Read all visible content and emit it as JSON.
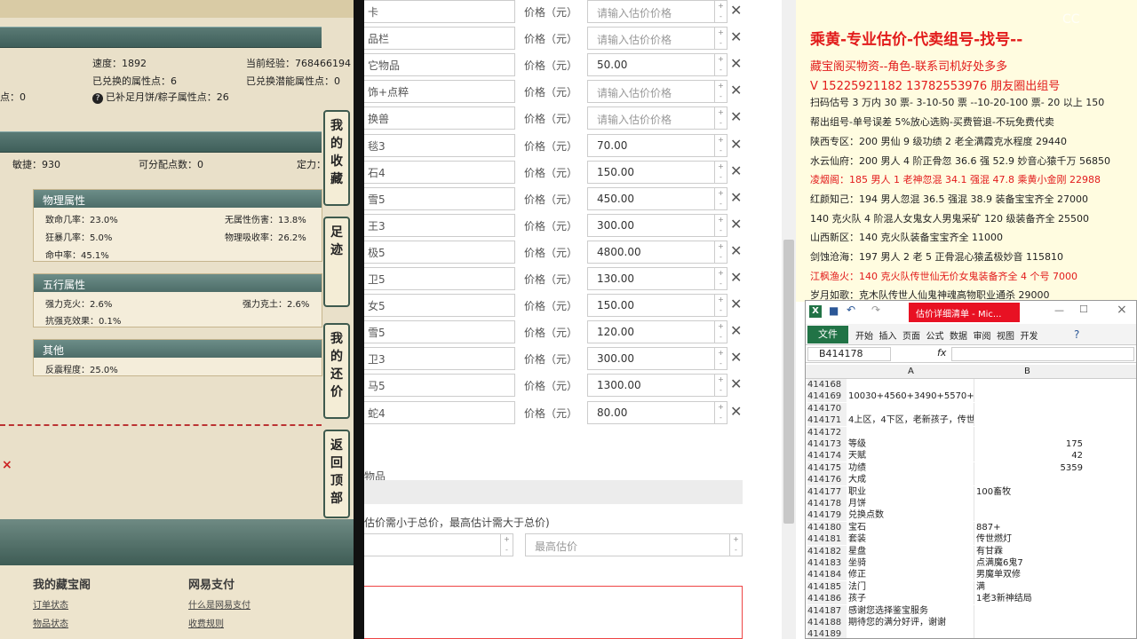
{
  "game": {
    "stats_row1": [
      "速度：1892",
      "当前经验：768466194"
    ],
    "stats_row2": [
      "已兑换的属性点：6",
      "已兑换潜能属性点：0"
    ],
    "stats_row3": [
      "点：0",
      "已补足月饼/粽子属性点：26"
    ],
    "stats_row4": [
      "敏捷：930",
      "可分配点数：0",
      "定力："
    ],
    "physical": {
      "title": "物理属性",
      "items": [
        "致命几率：23.0%",
        "无属性伤害：13.8%",
        "狂暴几率：5.0%",
        "物理吸收率：26.2%",
        "命中率：45.1%"
      ]
    },
    "five_elements": {
      "title": "五行属性",
      "items": [
        "强力克火：2.6%",
        "强力克土：2.6%",
        "抗强克效果：0.1%"
      ]
    },
    "other": {
      "title": "其他",
      "items": [
        "反震程度：25.0%"
      ]
    },
    "tabs": [
      "我的收藏",
      "足迹",
      "我的还价",
      "返回顶部"
    ],
    "footer": {
      "col1_title": "我的藏宝阁",
      "col1_links": [
        "订单状态",
        "物品状态"
      ],
      "col2_title": "网易支付",
      "col2_links": [
        "什么是网易支付",
        "收费规则"
      ]
    }
  },
  "form": {
    "price_label": "价格（元）",
    "placeholder": "请输入估价价格",
    "rows": [
      {
        "name": "卡",
        "price": ""
      },
      {
        "name": "品栏",
        "price": ""
      },
      {
        "name": "它物品",
        "price": "50.00"
      },
      {
        "name": "饰+点粹",
        "price": ""
      },
      {
        "name": "换兽",
        "price": ""
      },
      {
        "name": "毯3",
        "price": "70.00"
      },
      {
        "name": "石4",
        "price": "150.00"
      },
      {
        "name": "雪5",
        "price": "450.00"
      },
      {
        "name": "王3",
        "price": "300.00"
      },
      {
        "name": "极5",
        "price": "4800.00"
      },
      {
        "name": "卫5",
        "price": "130.00"
      },
      {
        "name": "女5",
        "price": "150.00"
      },
      {
        "name": "雪5",
        "price": "120.00"
      },
      {
        "name": "卫3",
        "price": "300.00"
      },
      {
        "name": "马5",
        "price": "1300.00"
      },
      {
        "name": "蛇4",
        "price": "80.00"
      }
    ],
    "section_label": "物品",
    "hint": "估价需小于总价，最高估计需大于总价)",
    "max_placeholder": "最高估价"
  },
  "ad": {
    "title": "乘黄-专业估价-代卖组号-找号--",
    "lines": [
      {
        "text": "藏宝阁买物资--角色-联系司机好处多多",
        "red": true
      },
      {
        "text": "V 15225921182   13782553976 朋友圈出组号",
        "red": true
      },
      {
        "text": "扫码估号 3 万内 30 票- 3-10-50 票  --10-20-100 票- 20 以上 150",
        "red": false
      },
      {
        "text": "帮出组号-单号误差 5%放心选购-买费管退-不玩免费代卖",
        "red": false
      },
      {
        "text": "陕西专区：200 男仙 9 级功绩 2 老全满霞克水程度 29440",
        "red": false
      },
      {
        "text": "水云仙府：200 男人 4 阶正骨忽 36.6 强 52.9 妙音心猿千万 56850",
        "red": false
      },
      {
        "text": "凌烟阁：185 男人 1 老神忽混 34.1 强混 47.8 乘黄小金刚 22988",
        "red": true
      },
      {
        "text": "红颜知己：194 男人忽混 36.5 强混 38.9 装备宝宝齐全 27000",
        "red": false
      },
      {
        "text": "140 克火队 4 阶混人女鬼女人男鬼采矿 120 级装备齐全 25500",
        "red": false
      },
      {
        "text": "山西新区：140 克火队装备宝宝齐全 11000",
        "red": false
      },
      {
        "text": "剑蚀沧海：197 男人 2 老 5 正骨混心猿孟极妙音 115810",
        "red": false
      },
      {
        "text": "江枫渔火：140 克火队传世仙无价女鬼装备齐全 4 个号 7000",
        "red": true
      },
      {
        "text": "岁月如歌：克木队传世人仙鬼神魂高物职业通杀 29000",
        "red": false
      }
    ]
  },
  "excel": {
    "title": "估价详细清单 - Mic...",
    "file_tab": "文件",
    "tabs": [
      "开始",
      "插入",
      "页面",
      "公式",
      "数据",
      "审阅",
      "视图",
      "开发"
    ],
    "cell_ref": "B414178",
    "fx": "fx",
    "col_a": "A",
    "col_b": "B",
    "rows": [
      {
        "n": "414168",
        "a": "",
        "b": ""
      },
      {
        "n": "414169",
        "a": "10030+4560+3490+5570+6830=30480",
        "b": ""
      },
      {
        "n": "414170",
        "a": "",
        "b": ""
      },
      {
        "n": "414171",
        "a": "4上区，4下区，老新孩子，传世，装备宝宝齐全",
        "b": ""
      },
      {
        "n": "414172",
        "a": "",
        "b": ""
      },
      {
        "n": "414173",
        "a": "等级",
        "b": "175",
        "num": true
      },
      {
        "n": "414174",
        "a": "天赋",
        "b": "42",
        "num": true
      },
      {
        "n": "414175",
        "a": "功绩",
        "b": "5359",
        "num": true
      },
      {
        "n": "414176",
        "a": "大成",
        "b": ""
      },
      {
        "n": "414177",
        "a": "职业",
        "b": "100畜牧"
      },
      {
        "n": "414178",
        "a": "月饼",
        "b": ""
      },
      {
        "n": "414179",
        "a": "兑换点数",
        "b": ""
      },
      {
        "n": "414180",
        "a": "宝石",
        "b": "887+"
      },
      {
        "n": "414181",
        "a": "套装",
        "b": "传世燃灯"
      },
      {
        "n": "414182",
        "a": "星盘",
        "b": "有甘霖"
      },
      {
        "n": "414183",
        "a": "坐骑",
        "b": "点满魔6鬼7"
      },
      {
        "n": "414184",
        "a": "修正",
        "b": "男魔单双修"
      },
      {
        "n": "414185",
        "a": "法门",
        "b": "满"
      },
      {
        "n": "414186",
        "a": "孩子",
        "b": "1老3新神结局"
      },
      {
        "n": "414187",
        "a": "感谢您选择鉴宝服务",
        "b": ""
      },
      {
        "n": "414188",
        "a": "期待您的满分好评，谢谢",
        "b": ""
      },
      {
        "n": "414189",
        "a": "",
        "b": ""
      }
    ]
  }
}
